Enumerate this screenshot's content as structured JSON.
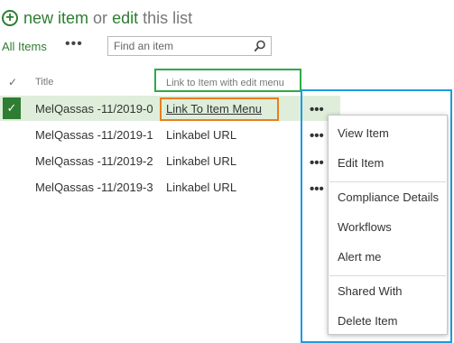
{
  "header": {
    "plus_glyph": "+",
    "new_item_label": "new item",
    "or_label": "or",
    "edit_label": "edit",
    "this_list_label": "this list"
  },
  "views": {
    "all_items_label": "All Items",
    "more_glyph": "•••"
  },
  "search": {
    "placeholder": "Find an item"
  },
  "columns": {
    "check_glyph": "✓",
    "title": "Title",
    "link": "Link to Item with edit menu"
  },
  "rows": [
    {
      "title": "MelQassas -11/2019-0",
      "link": "Link To Item Menu",
      "selected": true
    },
    {
      "title": "MelQassas -11/2019-1",
      "link": "Linkabel URL",
      "selected": false
    },
    {
      "title": "MelQassas -11/2019-2",
      "link": "Linkabel URL",
      "selected": false
    },
    {
      "title": "MelQassas -11/2019-3",
      "link": "Linkabel URL",
      "selected": false
    }
  ],
  "row_check_glyph": "✓",
  "row_more_glyph": "•••",
  "menu": {
    "items": [
      "View Item",
      "Edit Item",
      "Compliance Details",
      "Workflows",
      "Alert me",
      "Shared With",
      "Delete Item"
    ]
  },
  "colors": {
    "brand_green": "#2e7d32",
    "selected_row": "#dfeedb",
    "annotation_green": "#2eaa4a",
    "annotation_orange": "#e87f1e",
    "annotation_blue": "#1e9be0"
  },
  "icons": [
    "plus-circle-icon",
    "search-icon",
    "more-icon",
    "check-icon"
  ]
}
